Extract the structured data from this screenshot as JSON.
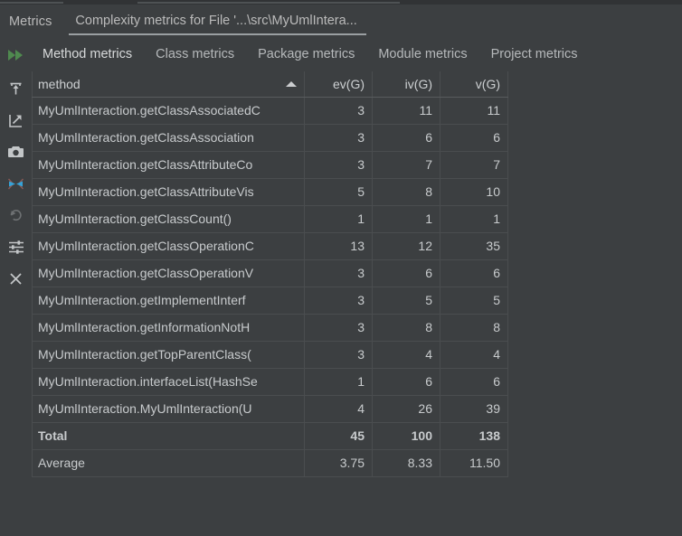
{
  "window": {
    "tool_label": "Metrics",
    "tab_title": "Complexity metrics for File '...\\src\\MyUmlIntera...",
    "background_color": "#3c3f41",
    "accent_color": "#3d85d8",
    "warning_color": "#e8555a"
  },
  "tabs": {
    "run_icon": "run-double-arrow-icon",
    "items": [
      {
        "label": "Method metrics",
        "active": true
      },
      {
        "label": "Class metrics",
        "active": false
      },
      {
        "label": "Package metrics",
        "active": false
      },
      {
        "label": "Module metrics",
        "active": false
      },
      {
        "label": "Project metrics",
        "active": false
      }
    ]
  },
  "toolbar_rail": {
    "items": [
      {
        "icon": "export-to-file-icon",
        "enabled": true
      },
      {
        "icon": "open-external-icon",
        "enabled": true
      },
      {
        "icon": "camera-snapshot-icon",
        "enabled": true
      },
      {
        "icon": "collapse-arrows-icon",
        "enabled": true
      },
      {
        "icon": "undo-icon",
        "enabled": false
      },
      {
        "icon": "settings-sliders-icon",
        "enabled": true
      },
      {
        "icon": "close-icon",
        "enabled": true
      }
    ]
  },
  "table": {
    "columns": [
      {
        "key": "method",
        "label": "method",
        "align": "left",
        "sorted": "asc"
      },
      {
        "key": "ev",
        "label": "ev(G)",
        "align": "right",
        "sorted": null
      },
      {
        "key": "iv",
        "label": "iv(G)",
        "align": "right",
        "sorted": null
      },
      {
        "key": "v",
        "label": "v(G)",
        "align": "right",
        "sorted": null
      }
    ],
    "rows": [
      {
        "method": "MyUmlInteraction.getClassAssociatedC",
        "ev": "3",
        "iv": "11",
        "v": "11",
        "hot": {
          "ev": false,
          "iv": true,
          "v": true
        }
      },
      {
        "method": "MyUmlInteraction.getClassAssociation",
        "ev": "3",
        "iv": "6",
        "v": "6",
        "hot": {
          "ev": false,
          "iv": false,
          "v": false
        }
      },
      {
        "method": "MyUmlInteraction.getClassAttributeCo",
        "ev": "3",
        "iv": "7",
        "v": "7",
        "hot": {
          "ev": false,
          "iv": false,
          "v": false
        }
      },
      {
        "method": "MyUmlInteraction.getClassAttributeVis",
        "ev": "5",
        "iv": "8",
        "v": "10",
        "hot": {
          "ev": true,
          "iv": false,
          "v": false
        }
      },
      {
        "method": "MyUmlInteraction.getClassCount()",
        "ev": "1",
        "iv": "1",
        "v": "1",
        "hot": {
          "ev": false,
          "iv": false,
          "v": false
        }
      },
      {
        "method": "MyUmlInteraction.getClassOperationC",
        "ev": "13",
        "iv": "12",
        "v": "35",
        "hot": {
          "ev": true,
          "iv": true,
          "v": true
        }
      },
      {
        "method": "MyUmlInteraction.getClassOperationV",
        "ev": "3",
        "iv": "6",
        "v": "6",
        "hot": {
          "ev": false,
          "iv": false,
          "v": false
        }
      },
      {
        "method": "MyUmlInteraction.getImplementInterf",
        "ev": "3",
        "iv": "5",
        "v": "5",
        "hot": {
          "ev": false,
          "iv": false,
          "v": false
        }
      },
      {
        "method": "MyUmlInteraction.getInformationNotH",
        "ev": "3",
        "iv": "8",
        "v": "8",
        "hot": {
          "ev": false,
          "iv": false,
          "v": false
        }
      },
      {
        "method": "MyUmlInteraction.getTopParentClass(",
        "ev": "3",
        "iv": "4",
        "v": "4",
        "hot": {
          "ev": false,
          "iv": false,
          "v": false
        }
      },
      {
        "method": "MyUmlInteraction.interfaceList(HashSe",
        "ev": "1",
        "iv": "6",
        "v": "6",
        "hot": {
          "ev": false,
          "iv": false,
          "v": false
        }
      },
      {
        "method": "MyUmlInteraction.MyUmlInteraction(U",
        "ev": "4",
        "iv": "26",
        "v": "39",
        "hot": {
          "ev": true,
          "iv": true,
          "v": true
        }
      }
    ],
    "summary": [
      {
        "label": "Total",
        "ev": "45",
        "iv": "100",
        "v": "138",
        "bold": true
      },
      {
        "label": "Average",
        "ev": "3.75",
        "iv": "8.33",
        "v": "11.50",
        "bold": false
      }
    ]
  }
}
